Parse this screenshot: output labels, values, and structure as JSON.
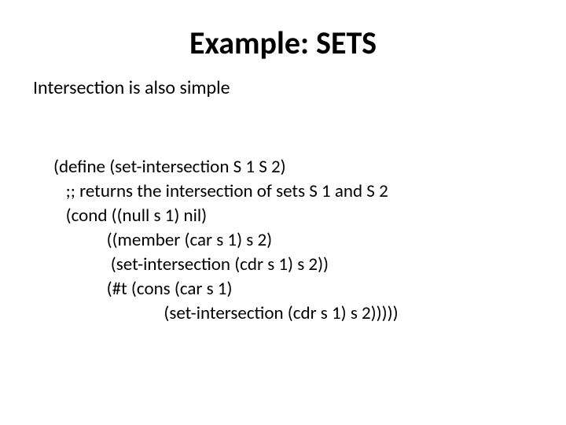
{
  "title": "Example: SETS",
  "subtitle": "Intersection is also simple",
  "code": {
    "l1": "(define (set-intersection S 1 S 2)",
    "l2": "   ;; returns the intersection of sets S 1 and S 2",
    "l3": "   (cond ((null s 1) nil)",
    "l4": "             ((member (car s 1) s 2)",
    "l5": "              (set-intersection (cdr s 1) s 2))",
    "l6": "             (#t (cons (car s 1)",
    "l7": "                           (set-intersection (cdr s 1) s 2)))))"
  }
}
